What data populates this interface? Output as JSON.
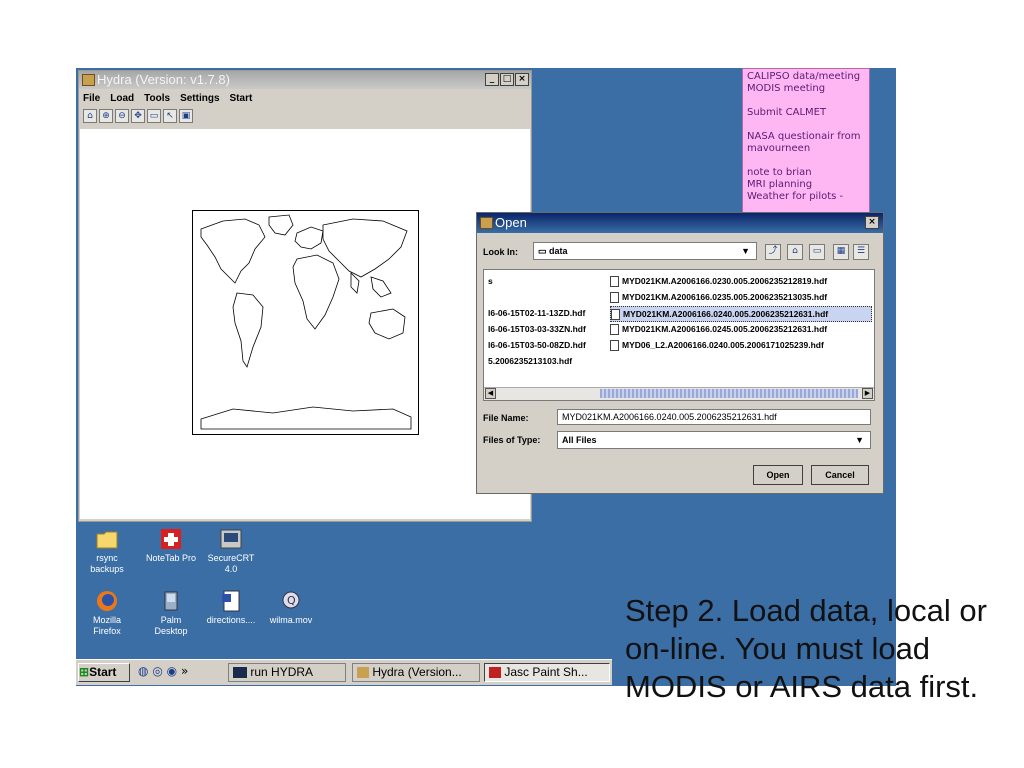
{
  "hydra": {
    "title": "Hydra  (Version: v1.7.8)",
    "menu": [
      "File",
      "Load",
      "Tools",
      "Settings",
      "Start"
    ],
    "toolbar_icons": [
      "home-icon",
      "zoom-in-icon",
      "zoom-out-icon",
      "pan-icon",
      "rectangle-icon",
      "pointer-icon",
      "window-icon"
    ]
  },
  "sticky_note": {
    "lines": [
      "CALIPSO data/meeting",
      "MODIS meeting",
      "",
      "Submit CALMET",
      "",
      "NASA questionair from",
      "mavourneen",
      "",
      "note to brian",
      "MRI planning",
      "Weather for pilots -"
    ]
  },
  "open_dialog": {
    "title": "Open",
    "look_in_label": "Look In:",
    "look_in_value": "data",
    "files_left": [
      "s",
      "",
      "l6-06-15T02-11-13ZD.hdf",
      "l6-06-15T03-03-33ZN.hdf",
      "l6-06-15T03-50-08ZD.hdf",
      "5.2006235213103.hdf"
    ],
    "files_right": [
      "MYD021KM.A2006166.0230.005.2006235212819.hdf",
      "MYD021KM.A2006166.0235.005.2006235213035.hdf",
      "MYD021KM.A2006166.0240.005.2006235212631.hdf",
      "MYD021KM.A2006166.0245.005.2006235212631.hdf",
      "MYD06_L2.A2006166.0240.005.2006171025239.hdf"
    ],
    "selected_index": 2,
    "file_name_label": "File Name:",
    "file_name_value": "MYD021KM.A2006166.0240.005.2006235212631.hdf",
    "file_type_label": "Files of Type:",
    "file_type_value": "All Files",
    "open_label": "Open",
    "cancel_label": "Cancel"
  },
  "desktop_icons": [
    {
      "label": "rsync backups",
      "line1": "rsync",
      "line2": "backups",
      "icon": "folder-icon"
    },
    {
      "label": "NoteTab Pro",
      "line1": "NoteTab Pro",
      "line2": "",
      "icon": "notetab-icon"
    },
    {
      "label": "SecureCRT 4.0",
      "line1": "SecureCRT",
      "line2": "4.0",
      "icon": "securecrt-icon"
    },
    {
      "label": "Mozilla Firefox",
      "line1": "Mozilla",
      "line2": "Firefox",
      "icon": "firefox-icon"
    },
    {
      "label": "Palm Desktop",
      "line1": "Palm",
      "line2": "Desktop",
      "icon": "palm-icon"
    },
    {
      "label": "directions....",
      "line1": "directions....",
      "line2": "",
      "icon": "word-doc-icon"
    },
    {
      "label": "wilma.mov",
      "line1": "wilma.mov",
      "line2": "",
      "icon": "quicktime-icon"
    }
  ],
  "taskbar": {
    "start_label": "Start",
    "chevron": "»",
    "items": [
      "run HYDRA",
      "Hydra  (Version...",
      "Jasc Paint Sh..."
    ]
  },
  "caption": {
    "text": "Step 2. Load data, local or on-line. You must load MODIS or AIRS data first."
  },
  "colors": {
    "desktop": "#3a6ea5",
    "sticky": "#ffb7f4",
    "dialog_title": "#0a246a",
    "selection": "#c9d4f0"
  }
}
